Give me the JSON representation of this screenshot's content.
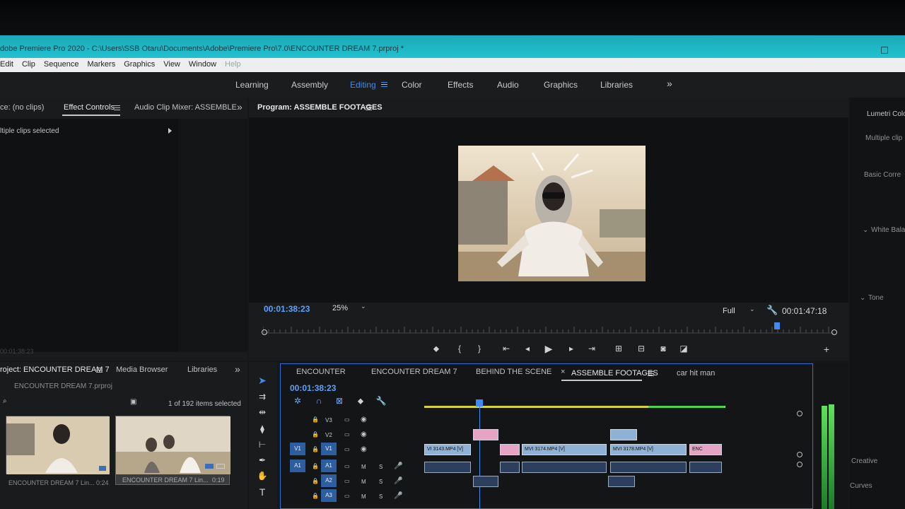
{
  "window": {
    "title": "dobe Premiere Pro 2020 - C:\\Users\\SSB Otaru\\Documents\\Adobe\\Premiere Pro\\7.0\\ENCOUNTER DREAM 7.prproj *"
  },
  "menu": [
    "Edit",
    "Clip",
    "Sequence",
    "Markers",
    "Graphics",
    "View",
    "Window",
    "Help"
  ],
  "workspaces": {
    "items": [
      "Learning",
      "Assembly",
      "Editing",
      "Color",
      "Effects",
      "Audio",
      "Graphics",
      "Libraries"
    ],
    "active": "Editing",
    "more": "»"
  },
  "source_panel": {
    "tabs": [
      "ce: (no clips)",
      "Effect Controls",
      "Audio Clip Mixer: ASSEMBLE"
    ],
    "active_tab": "Effect Controls",
    "more": "»",
    "message": "ltiple clips selected",
    "bottom_timecode": "00:01:38:23"
  },
  "program": {
    "title": "Program: ASSEMBLE FOOTAGES",
    "timecode": "00:01:38:23",
    "zoom": "25%",
    "quality": "Full",
    "duration": "00:01:47:18",
    "playhead_fraction": 0.9
  },
  "project_panel": {
    "tabs": [
      "roject: ENCOUNTER DREAM 7",
      "Media Browser",
      "Libraries"
    ],
    "more": "»",
    "file": "ENCOUNTER DREAM 7.prproj",
    "selection_count": "1 of 192 items selected",
    "thumbnails": [
      {
        "label": "ENCOUNTER DREAM 7 Lin...",
        "duration": "0:24"
      },
      {
        "label": "ENCOUNTER DREAM 7 Lin...",
        "duration": "0:19"
      }
    ]
  },
  "timeline": {
    "tabs": [
      "ENCOUNTER",
      "ENCOUNTER DREAM 7",
      "BEHIND THE SCENE",
      "ASSEMBLE FOOTAGES",
      "car hit man"
    ],
    "active_tab": "ASSEMBLE FOOTAGES",
    "timecode": "00:01:38:23",
    "tracks": {
      "video": [
        "V3",
        "V2",
        "V1"
      ],
      "audio": [
        "A1",
        "A2",
        "A3"
      ],
      "source_v": "V1",
      "source_a": "A1",
      "mute": "M",
      "solo": "S"
    },
    "clips": {
      "c1": "VI 3143.MP4 [V]",
      "c2": "MVI 3174.MP4 [V]",
      "c3": "MVI 3178.MP4 [V]",
      "c4": "ENC"
    }
  },
  "lumetri": {
    "title": "Lumetri Colo",
    "subtitle": "Multiple clip",
    "section1": "Basic Corre",
    "section2": "White Bala",
    "section3": "Tone",
    "creative": "Creative",
    "curves": "Curves"
  },
  "colors": {
    "accent": "#3d8bf2",
    "titlebar": "#23c3d0",
    "clip_blue": "#8fb1d6",
    "clip_pink": "#e7a3c4"
  }
}
